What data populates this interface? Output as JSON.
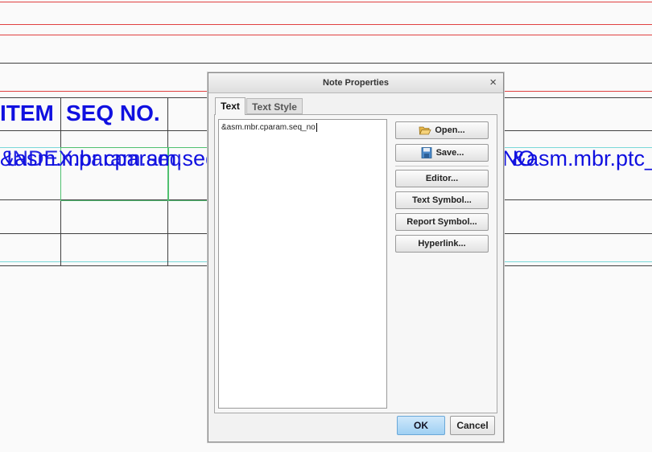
{
  "drawing": {
    "header_item": "ITEM",
    "header_seq": "SEQ NO.",
    "overlap_text_a": "&asm.mbr.cparam.seq_",
    "overlap_text_b": "INDEX.param.seq",
    "overlap_text_c": "&asm.mbr.ptc_",
    "overlap_text_d": "NO",
    "colors": {
      "text": "#1010e0",
      "red_line": "#e04040",
      "cyan_line": "#7ad8d8",
      "green_box": "#50c070"
    }
  },
  "dialog": {
    "title": "Note Properties",
    "close_glyph": "×",
    "tabs": [
      {
        "label": "Text",
        "active": true
      },
      {
        "label": "Text Style",
        "active": false
      }
    ],
    "text_value": "&asm.mbr.cparam.seq_no",
    "buttons": {
      "open": "Open...",
      "save": "Save...",
      "editor": "Editor...",
      "text_symbol": "Text Symbol...",
      "report_symbol": "Report Symbol...",
      "hyperlink": "Hyperlink..."
    },
    "ok": "OK",
    "cancel": "Cancel",
    "icons": {
      "open": "folder-open-icon",
      "save": "floppy-disk-icon"
    }
  }
}
